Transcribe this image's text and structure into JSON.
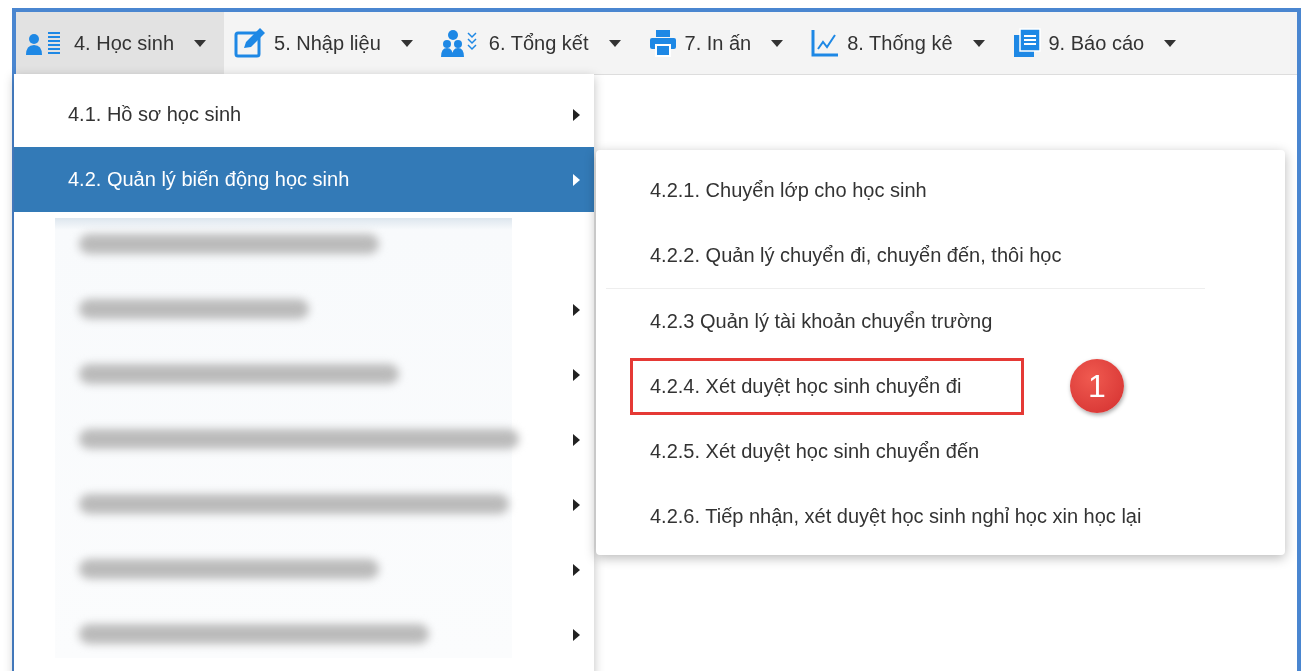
{
  "menubar": {
    "tabs": [
      {
        "label": "4. Học sinh",
        "selected": true
      },
      {
        "label": "5. Nhập liệu",
        "selected": false
      },
      {
        "label": "6. Tổng kết",
        "selected": false
      },
      {
        "label": "7. In ấn",
        "selected": false
      },
      {
        "label": "8. Thống kê",
        "selected": false
      },
      {
        "label": "9. Báo cáo",
        "selected": false
      }
    ]
  },
  "menu": {
    "items": [
      {
        "kind": "entry",
        "label": "4.1. Hồ sơ học sinh",
        "has_submenu": true,
        "selected": false
      },
      {
        "kind": "entry",
        "label": "4.2. Quản lý biến động học sinh",
        "has_submenu": true,
        "selected": true
      },
      {
        "kind": "blurred",
        "has_submenu": false
      },
      {
        "kind": "blurred",
        "has_submenu": true
      },
      {
        "kind": "blurred",
        "has_submenu": true
      },
      {
        "kind": "blurred",
        "has_submenu": true
      },
      {
        "kind": "blurred",
        "has_submenu": true
      },
      {
        "kind": "blurred",
        "has_submenu": true
      },
      {
        "kind": "blurred",
        "has_submenu": true
      }
    ]
  },
  "submenu": {
    "items": [
      {
        "label": "4.2.1. Chuyển lớp cho học sinh",
        "highlighted": false
      },
      {
        "label": "4.2.2. Quản lý chuyển đi, chuyển đến, thôi học",
        "highlighted": false
      },
      {
        "label": "4.2.3 Quản lý tài khoản chuyển trường",
        "highlighted": false
      },
      {
        "label": "4.2.4. Xét duyệt học sinh chuyển đi",
        "highlighted": true
      },
      {
        "label": "4.2.5. Xét duyệt học sinh chuyển đến",
        "highlighted": false
      },
      {
        "label": "4.2.6. Tiếp nhận, xét duyệt học sinh nghỉ học xin học lại",
        "highlighted": false
      }
    ],
    "badge": "1"
  }
}
